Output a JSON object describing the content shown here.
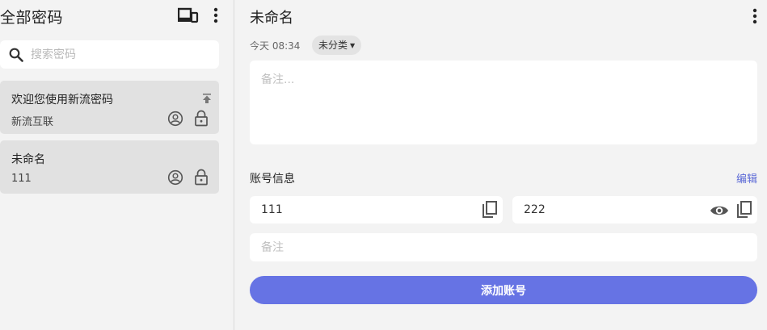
{
  "sidebar": {
    "title": "全部密码",
    "search": {
      "placeholder": "搜索密码",
      "value": ""
    },
    "entries": [
      {
        "title": "欢迎您使用新流密码",
        "subtitle": "新流互联",
        "icons": [
          "pin-upload-icon",
          "account-circle-icon",
          "lock-icon"
        ]
      },
      {
        "title": "未命名",
        "subtitle": "111",
        "icons": [
          "account-circle-icon",
          "lock-icon"
        ]
      }
    ]
  },
  "main": {
    "title": "未命名",
    "date": "今天 08:34",
    "category": "未分类",
    "note_placeholder": "备注...",
    "account_section": {
      "title": "账号信息",
      "edit_label": "编辑",
      "username": "111",
      "password": "222",
      "note_placeholder": "备注"
    },
    "add_button_label": "添加账号"
  },
  "colors": {
    "accent": "#6673e4",
    "link": "#5b69d6",
    "selected_entry_bg": "#e1e1e1",
    "app_bg": "#f3f3f3"
  }
}
